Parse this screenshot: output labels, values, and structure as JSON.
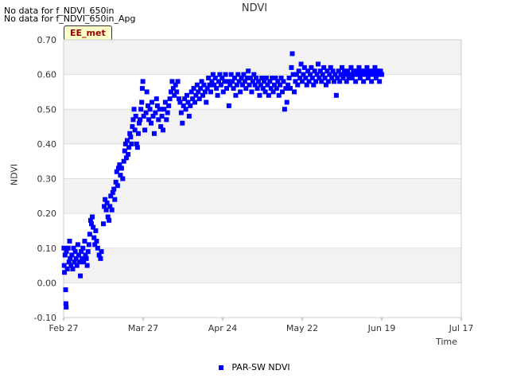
{
  "notes": [
    "No data for f_NDVI_650in",
    "No data for f_NDVI_650in_Apg"
  ],
  "badge": "EE_met",
  "chart_data": {
    "type": "scatter",
    "title": "NDVI",
    "xlabel": "Time",
    "ylabel": "NDVI",
    "x_ticks": [
      "Feb 27",
      "Mar 27",
      "Apr 24",
      "May 22",
      "Jun 19",
      "Jul 17"
    ],
    "y_ticks": [
      "-0.10",
      "0.00",
      "0.10",
      "0.20",
      "0.30",
      "0.40",
      "0.50",
      "0.60",
      "0.70"
    ],
    "xlim": [
      "Feb 27",
      "Jul 17"
    ],
    "ylim": [
      -0.1,
      0.7
    ],
    "grid": "alternating horizontal bands",
    "legend_position": "bottom-center",
    "series_color": "#0000ff",
    "series": [
      {
        "name": "PAR-SW NDVI",
        "note": "x values in days since Feb 27",
        "points": [
          [
            0.1,
            0.1
          ],
          [
            0.2,
            0.05
          ],
          [
            0.3,
            0.03
          ],
          [
            0.5,
            0.08
          ],
          [
            0.7,
            -0.02
          ],
          [
            0.8,
            -0.06
          ],
          [
            0.9,
            -0.07
          ],
          [
            1.0,
            0.09
          ],
          [
            1.3,
            0.04
          ],
          [
            1.6,
            0.1
          ],
          [
            1.9,
            0.06
          ],
          [
            2.1,
            0.12
          ],
          [
            2.3,
            0.07
          ],
          [
            2.6,
            0.05
          ],
          [
            2.9,
            0.08
          ],
          [
            3.2,
            0.04
          ],
          [
            3.5,
            0.1
          ],
          [
            3.8,
            0.06
          ],
          [
            4.1,
            0.09
          ],
          [
            4.4,
            0.07
          ],
          [
            4.7,
            0.05
          ],
          [
            5.0,
            0.11
          ],
          [
            5.3,
            0.08
          ],
          [
            5.6,
            0.06
          ],
          [
            5.9,
            0.02
          ],
          [
            6.2,
            0.09
          ],
          [
            6.5,
            0.07
          ],
          [
            6.8,
            0.1
          ],
          [
            7.1,
            0.06
          ],
          [
            7.4,
            0.12
          ],
          [
            7.7,
            0.08
          ],
          [
            8.0,
            0.07
          ],
          [
            8.3,
            0.05
          ],
          [
            8.6,
            0.09
          ],
          [
            8.9,
            0.11
          ],
          [
            9.2,
            0.14
          ],
          [
            9.5,
            0.18
          ],
          [
            9.8,
            0.17
          ],
          [
            10.1,
            0.19
          ],
          [
            10.4,
            0.16
          ],
          [
            10.7,
            0.13
          ],
          [
            11.0,
            0.11
          ],
          [
            11.3,
            0.15
          ],
          [
            11.6,
            0.12
          ],
          [
            12.0,
            0.1
          ],
          [
            12.5,
            0.08
          ],
          [
            13.0,
            0.07
          ],
          [
            13.3,
            0.09
          ],
          [
            14.0,
            0.17
          ],
          [
            14.3,
            0.22
          ],
          [
            14.6,
            0.24
          ],
          [
            15.0,
            0.21
          ],
          [
            15.3,
            0.23
          ],
          [
            15.6,
            0.19
          ],
          [
            16.0,
            0.18
          ],
          [
            16.3,
            0.22
          ],
          [
            16.6,
            0.25
          ],
          [
            17.0,
            0.21
          ],
          [
            17.3,
            0.26
          ],
          [
            17.7,
            0.27
          ],
          [
            18.0,
            0.24
          ],
          [
            18.4,
            0.29
          ],
          [
            18.7,
            0.32
          ],
          [
            19.0,
            0.28
          ],
          [
            19.3,
            0.33
          ],
          [
            19.7,
            0.34
          ],
          [
            20.0,
            0.31
          ],
          [
            20.4,
            0.33
          ],
          [
            20.8,
            0.3
          ],
          [
            21.2,
            0.35
          ],
          [
            21.5,
            0.38
          ],
          [
            21.8,
            0.4
          ],
          [
            22.1,
            0.36
          ],
          [
            22.4,
            0.41
          ],
          [
            22.7,
            0.37
          ],
          [
            23.0,
            0.39
          ],
          [
            23.3,
            0.43
          ],
          [
            23.6,
            0.42
          ],
          [
            23.9,
            0.4
          ],
          [
            24.2,
            0.45
          ],
          [
            24.5,
            0.47
          ],
          [
            24.8,
            0.5
          ],
          [
            25.1,
            0.44
          ],
          [
            25.4,
            0.48
          ],
          [
            25.7,
            0.4
          ],
          [
            26.0,
            0.39
          ],
          [
            26.3,
            0.43
          ],
          [
            26.6,
            0.46
          ],
          [
            26.9,
            0.47
          ],
          [
            27.2,
            0.5
          ],
          [
            27.5,
            0.52
          ],
          [
            27.7,
            0.56
          ],
          [
            27.9,
            0.58
          ],
          [
            28.2,
            0.48
          ],
          [
            28.6,
            0.44
          ],
          [
            29.0,
            0.49
          ],
          [
            29.3,
            0.55
          ],
          [
            29.7,
            0.51
          ],
          [
            30.0,
            0.47
          ],
          [
            30.4,
            0.5
          ],
          [
            30.8,
            0.46
          ],
          [
            31.1,
            0.52
          ],
          [
            31.5,
            0.48
          ],
          [
            31.9,
            0.43
          ],
          [
            32.3,
            0.49
          ],
          [
            32.7,
            0.53
          ],
          [
            33.0,
            0.51
          ],
          [
            33.4,
            0.47
          ],
          [
            33.8,
            0.5
          ],
          [
            34.2,
            0.45
          ],
          [
            34.6,
            0.48
          ],
          [
            35.0,
            0.44
          ],
          [
            35.4,
            0.5
          ],
          [
            35.8,
            0.52
          ],
          [
            36.2,
            0.47
          ],
          [
            36.6,
            0.49
          ],
          [
            37.0,
            0.51
          ],
          [
            37.4,
            0.53
          ],
          [
            37.8,
            0.55
          ],
          [
            38.2,
            0.58
          ],
          [
            38.6,
            0.56
          ],
          [
            39.0,
            0.54
          ],
          [
            39.4,
            0.57
          ],
          [
            39.8,
            0.55
          ],
          [
            40.2,
            0.58
          ],
          [
            40.6,
            0.53
          ],
          [
            41.0,
            0.52
          ],
          [
            41.4,
            0.49
          ],
          [
            41.8,
            0.46
          ],
          [
            42.2,
            0.51
          ],
          [
            42.6,
            0.53
          ],
          [
            43.0,
            0.5
          ],
          [
            43.4,
            0.54
          ],
          [
            43.8,
            0.52
          ],
          [
            44.2,
            0.48
          ],
          [
            44.6,
            0.51
          ],
          [
            45.0,
            0.55
          ],
          [
            45.4,
            0.53
          ],
          [
            45.8,
            0.56
          ],
          [
            46.2,
            0.52
          ],
          [
            46.6,
            0.54
          ],
          [
            47.0,
            0.57
          ],
          [
            47.4,
            0.55
          ],
          [
            47.8,
            0.53
          ],
          [
            48.2,
            0.56
          ],
          [
            48.6,
            0.58
          ],
          [
            49.0,
            0.54
          ],
          [
            49.4,
            0.57
          ],
          [
            49.8,
            0.55
          ],
          [
            50.2,
            0.52
          ],
          [
            50.6,
            0.56
          ],
          [
            51.0,
            0.59
          ],
          [
            51.4,
            0.57
          ],
          [
            51.8,
            0.55
          ],
          [
            52.2,
            0.58
          ],
          [
            52.6,
            0.6
          ],
          [
            53.0,
            0.57
          ],
          [
            53.4,
            0.59
          ],
          [
            53.8,
            0.56
          ],
          [
            54.2,
            0.54
          ],
          [
            54.6,
            0.58
          ],
          [
            55.0,
            0.6
          ],
          [
            55.4,
            0.57
          ],
          [
            55.8,
            0.59
          ],
          [
            56.2,
            0.55
          ],
          [
            56.6,
            0.58
          ],
          [
            57.0,
            0.6
          ],
          [
            57.4,
            0.56
          ],
          [
            57.8,
            0.58
          ],
          [
            58.2,
            0.51
          ],
          [
            58.6,
            0.57
          ],
          [
            59.0,
            0.6
          ],
          [
            59.4,
            0.58
          ],
          [
            59.8,
            0.56
          ],
          [
            60.2,
            0.59
          ],
          [
            60.6,
            0.54
          ],
          [
            61.0,
            0.57
          ],
          [
            61.4,
            0.6
          ],
          [
            61.8,
            0.58
          ],
          [
            62.2,
            0.55
          ],
          [
            62.6,
            0.59
          ],
          [
            63.0,
            0.57
          ],
          [
            63.4,
            0.6
          ],
          [
            63.8,
            0.58
          ],
          [
            64.2,
            0.56
          ],
          [
            64.6,
            0.59
          ],
          [
            65.0,
            0.61
          ],
          [
            65.4,
            0.57
          ],
          [
            65.8,
            0.59
          ],
          [
            66.2,
            0.55
          ],
          [
            66.6,
            0.58
          ],
          [
            67.0,
            0.6
          ],
          [
            67.4,
            0.57
          ],
          [
            67.8,
            0.59
          ],
          [
            68.2,
            0.56
          ],
          [
            68.6,
            0.58
          ],
          [
            69.0,
            0.54
          ],
          [
            69.4,
            0.57
          ],
          [
            69.8,
            0.59
          ],
          [
            70.2,
            0.56
          ],
          [
            70.6,
            0.58
          ],
          [
            71.0,
            0.55
          ],
          [
            71.4,
            0.59
          ],
          [
            71.8,
            0.57
          ],
          [
            72.2,
            0.54
          ],
          [
            72.6,
            0.58
          ],
          [
            73.0,
            0.56
          ],
          [
            73.4,
            0.59
          ],
          [
            73.8,
            0.55
          ],
          [
            74.2,
            0.57
          ],
          [
            74.6,
            0.59
          ],
          [
            75.0,
            0.56
          ],
          [
            75.4,
            0.58
          ],
          [
            75.8,
            0.54
          ],
          [
            76.2,
            0.57
          ],
          [
            76.6,
            0.59
          ],
          [
            77.0,
            0.55
          ],
          [
            77.4,
            0.58
          ],
          [
            77.8,
            0.5
          ],
          [
            78.2,
            0.56
          ],
          [
            78.6,
            0.52
          ],
          [
            79.0,
            0.57
          ],
          [
            79.4,
            0.59
          ],
          [
            79.8,
            0.56
          ],
          [
            80.2,
            0.62
          ],
          [
            80.5,
            0.66
          ],
          [
            80.8,
            0.6
          ],
          [
            81.2,
            0.55
          ],
          [
            81.6,
            0.58
          ],
          [
            82.0,
            0.6
          ],
          [
            82.4,
            0.57
          ],
          [
            82.8,
            0.61
          ],
          [
            83.2,
            0.59
          ],
          [
            83.6,
            0.63
          ],
          [
            84.0,
            0.58
          ],
          [
            84.4,
            0.6
          ],
          [
            84.8,
            0.62
          ],
          [
            85.2,
            0.59
          ],
          [
            85.6,
            0.57
          ],
          [
            86.0,
            0.61
          ],
          [
            86.4,
            0.58
          ],
          [
            86.8,
            0.6
          ],
          [
            87.2,
            0.62
          ],
          [
            87.6,
            0.59
          ],
          [
            88.0,
            0.57
          ],
          [
            88.4,
            0.61
          ],
          [
            88.8,
            0.58
          ],
          [
            89.2,
            0.6
          ],
          [
            89.6,
            0.63
          ],
          [
            90.0,
            0.59
          ],
          [
            90.4,
            0.61
          ],
          [
            90.8,
            0.58
          ],
          [
            91.2,
            0.6
          ],
          [
            91.6,
            0.62
          ],
          [
            92.0,
            0.59
          ],
          [
            92.4,
            0.57
          ],
          [
            92.8,
            0.61
          ],
          [
            93.2,
            0.58
          ],
          [
            93.6,
            0.6
          ],
          [
            94.0,
            0.62
          ],
          [
            94.4,
            0.59
          ],
          [
            94.8,
            0.61
          ],
          [
            95.2,
            0.58
          ],
          [
            95.6,
            0.6
          ],
          [
            96.0,
            0.54
          ],
          [
            96.4,
            0.59
          ],
          [
            96.8,
            0.61
          ],
          [
            97.2,
            0.58
          ],
          [
            97.6,
            0.6
          ],
          [
            98.0,
            0.62
          ],
          [
            98.4,
            0.59
          ],
          [
            98.8,
            0.61
          ],
          [
            99.2,
            0.6
          ],
          [
            99.6,
            0.58
          ],
          [
            100.0,
            0.61
          ],
          [
            100.4,
            0.59
          ],
          [
            100.8,
            0.6
          ],
          [
            101.2,
            0.62
          ],
          [
            101.6,
            0.59
          ],
          [
            102.0,
            0.61
          ],
          [
            102.4,
            0.6
          ],
          [
            102.8,
            0.58
          ],
          [
            103.2,
            0.61
          ],
          [
            103.6,
            0.6
          ],
          [
            104.0,
            0.62
          ],
          [
            104.4,
            0.59
          ],
          [
            104.8,
            0.61
          ],
          [
            105.2,
            0.6
          ],
          [
            105.6,
            0.58
          ],
          [
            106.0,
            0.61
          ],
          [
            106.4,
            0.6
          ],
          [
            106.8,
            0.62
          ],
          [
            107.2,
            0.59
          ],
          [
            107.6,
            0.61
          ],
          [
            108.0,
            0.6
          ],
          [
            108.4,
            0.58
          ],
          [
            108.8,
            0.61
          ],
          [
            109.2,
            0.6
          ],
          [
            109.6,
            0.62
          ],
          [
            110.0,
            0.59
          ],
          [
            110.4,
            0.61
          ],
          [
            110.8,
            0.6
          ],
          [
            111.2,
            0.58
          ],
          [
            111.6,
            0.61
          ],
          [
            112.0,
            0.6
          ]
        ]
      }
    ]
  }
}
